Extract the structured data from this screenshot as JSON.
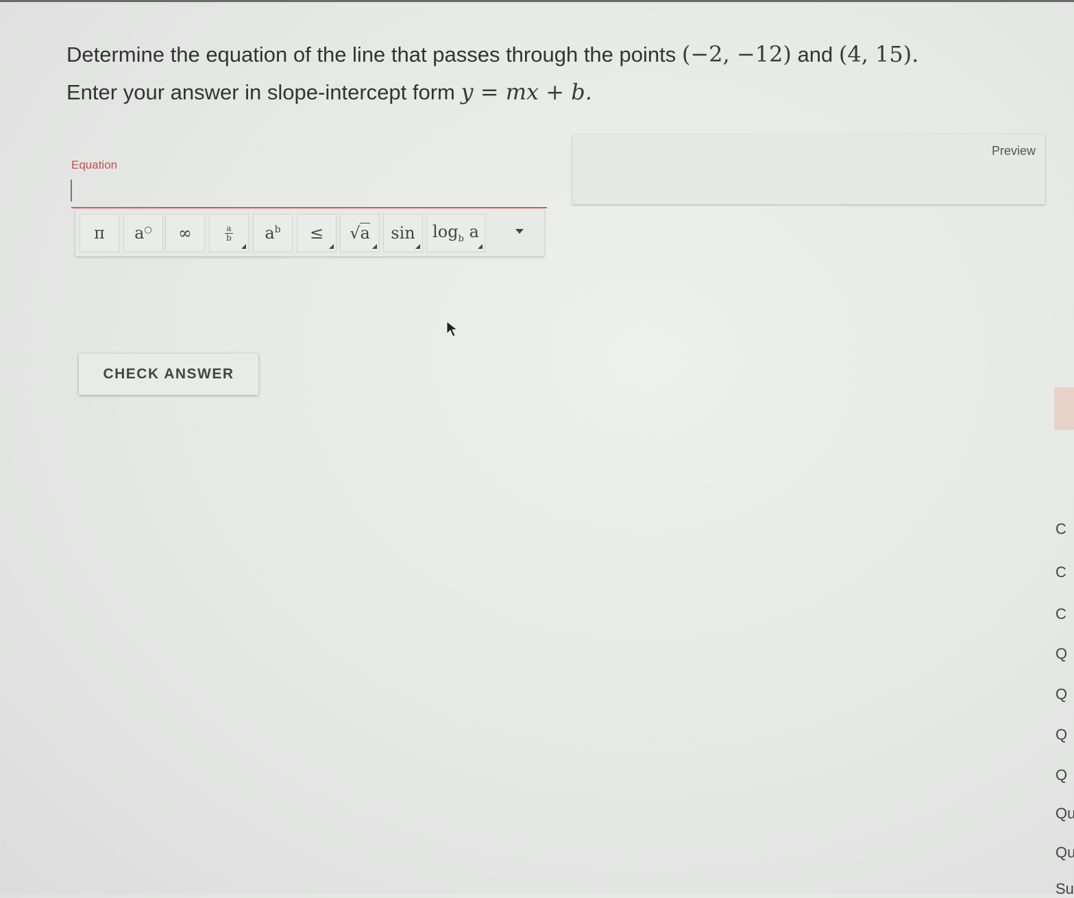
{
  "question": {
    "line1_prefix": "Determine the equation of the line that passes through the points ",
    "point1": "(−2, −12)",
    "line1_mid": " and ",
    "point2": "(4, 15).",
    "line2_prefix": "Enter your answer in slope-intercept form ",
    "form": "y = mx + b."
  },
  "equation_field": {
    "label": "Equation",
    "value": ""
  },
  "preview": {
    "label": "Preview"
  },
  "toolbar": {
    "buttons": [
      "π",
      "a°",
      "∞",
      "a/b",
      "aᵇ",
      "≤",
      "√a",
      "sin",
      "log_b a"
    ]
  },
  "check_button": {
    "label": "CHECK ANSWER"
  },
  "side_nav": [
    "C",
    "C",
    "C",
    "Q",
    "Q",
    "Q",
    "Q",
    "Qu",
    "Qu",
    "Su"
  ]
}
